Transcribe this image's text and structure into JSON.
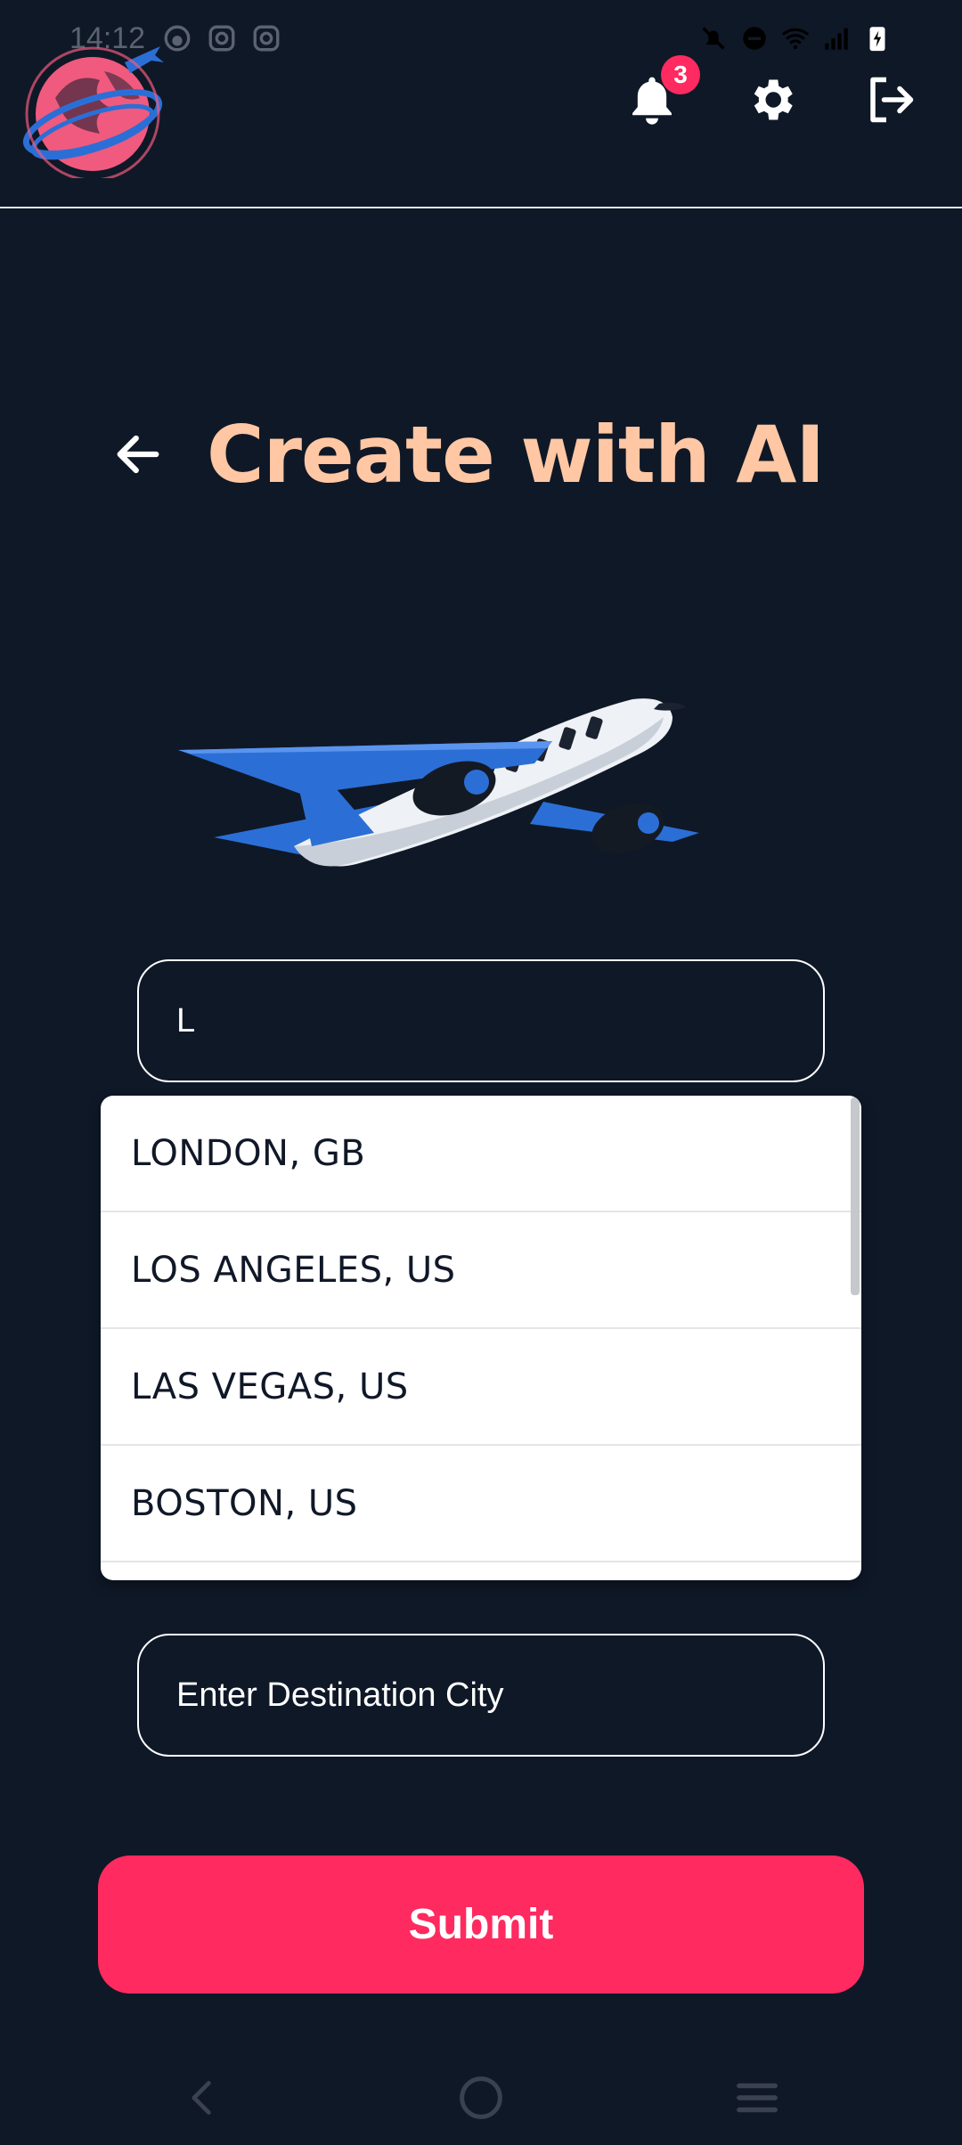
{
  "status_bar": {
    "time": "14:12",
    "left_icons": [
      "face-icon",
      "instagram-icon",
      "instagram-icon"
    ],
    "right_icons": [
      "bell-off-icon",
      "minus-circle-icon",
      "wifi-icon",
      "signal-icon",
      "battery-charging-icon"
    ]
  },
  "header": {
    "logo_icon": "globe-airplane-logo",
    "notifications_count": "3",
    "actions": [
      "bell-icon",
      "gear-icon",
      "logout-icon"
    ]
  },
  "page": {
    "title": "Create with AI",
    "back_icon": "arrow-left-icon",
    "illustration_icon": "airplane-illustration"
  },
  "form": {
    "origin_value": "L",
    "destination_placeholder": "Enter Destination City",
    "submit_label": "Submit"
  },
  "suggestions": [
    {
      "label": "LONDON, GB"
    },
    {
      "label": "LOS ANGELES, US"
    },
    {
      "label": "LAS VEGAS, US"
    },
    {
      "label": "BOSTON, US"
    }
  ],
  "nav_bar": {
    "buttons": [
      "chevron-left-icon",
      "circle-home-icon",
      "menu-icon"
    ]
  },
  "colors": {
    "background": "#0f1827",
    "accent": "#ff2a5f",
    "title": "#ffc7a3"
  }
}
